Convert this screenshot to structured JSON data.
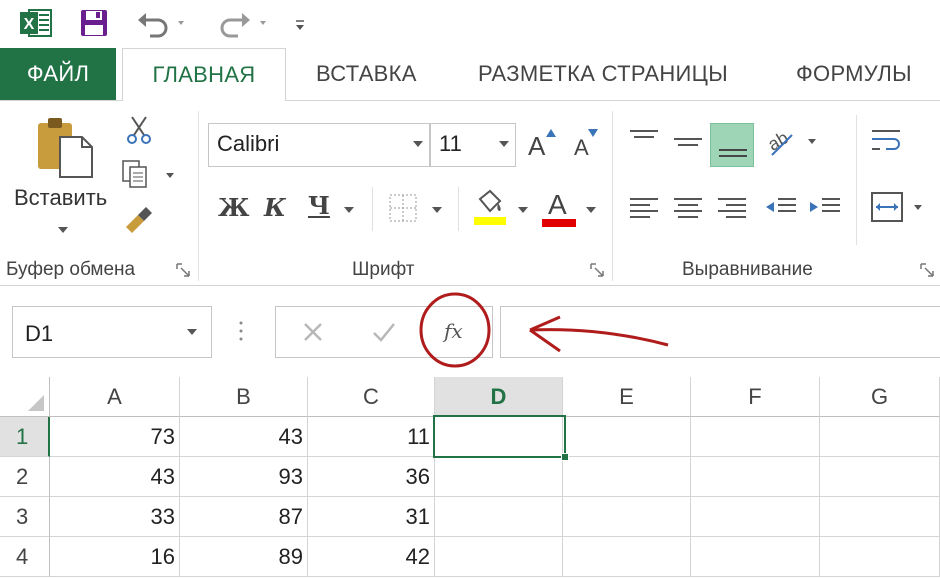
{
  "quick_access": {
    "icons": [
      "excel-logo-icon",
      "save-icon",
      "undo-icon",
      "redo-icon",
      "customize-qat-icon"
    ]
  },
  "tabs": {
    "file": "ФАЙЛ",
    "home": "ГЛАВНАЯ",
    "insert": "ВСТАВКА",
    "page_layout": "РАЗМЕТКА СТРАНИЦЫ",
    "formulas": "ФОРМУЛЫ"
  },
  "ribbon": {
    "clipboard": {
      "paste_label": "Вставить",
      "group_label": "Буфер обмена"
    },
    "font": {
      "font_name": "Calibri",
      "font_size": "11",
      "bold": "Ж",
      "italic": "К",
      "underline": "Ч",
      "grow": "A",
      "shrink": "A",
      "font_color_letter": "A",
      "group_label": "Шрифт",
      "highlight_color": "#ffff00",
      "font_color": "#e00000"
    },
    "alignment": {
      "group_label": "Выравнивание"
    }
  },
  "formula_bar": {
    "name_box": "D1",
    "fx_label": "fx",
    "formula_value": ""
  },
  "grid": {
    "columns": [
      "A",
      "B",
      "C",
      "D",
      "E",
      "F",
      "G"
    ],
    "selected_column": "D",
    "rows": [
      {
        "num": "1",
        "cells": [
          "73",
          "43",
          "11",
          "",
          "",
          "",
          ""
        ]
      },
      {
        "num": "2",
        "cells": [
          "43",
          "93",
          "36",
          "",
          "",
          "",
          ""
        ]
      },
      {
        "num": "3",
        "cells": [
          "33",
          "87",
          "31",
          "",
          "",
          "",
          ""
        ]
      },
      {
        "num": "4",
        "cells": [
          "16",
          "89",
          "42",
          "",
          "",
          "",
          ""
        ]
      }
    ],
    "selected_row": "1",
    "active_cell": "D1"
  },
  "colors": {
    "accent": "#217346",
    "annotation": "#b01c1c"
  }
}
